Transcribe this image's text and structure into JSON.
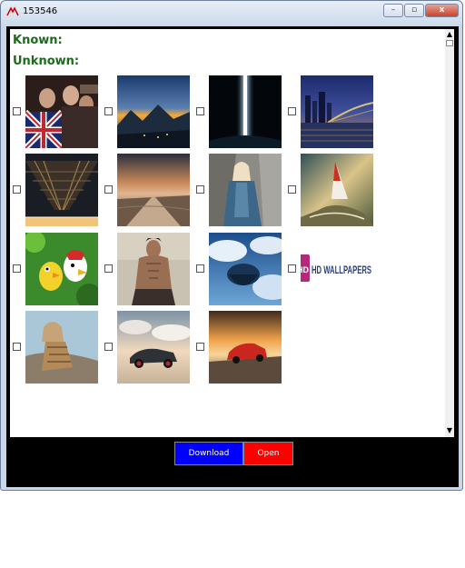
{
  "window": {
    "title": "153546",
    "minimize_label": "–",
    "maximize_label": "▫",
    "close_label": "x"
  },
  "labels": {
    "known": "Known:",
    "unknown": "Unknown:"
  },
  "gallery": {
    "images": [
      {
        "name": "movie-poster-three-men-flag",
        "checked": false
      },
      {
        "name": "mountain-sunset-town",
        "checked": false
      },
      {
        "name": "space-light-beam",
        "checked": false
      },
      {
        "name": "city-bridge-night",
        "checked": false
      },
      {
        "name": "bridge-underside-night",
        "checked": false
      },
      {
        "name": "beach-sunset-road",
        "checked": false
      },
      {
        "name": "woman-blue-cloak-rocks",
        "checked": false
      },
      {
        "name": "windsurfer-storm",
        "checked": false
      },
      {
        "name": "cartoon-birds-jungle",
        "checked": false
      },
      {
        "name": "wolverine-poster",
        "checked": false
      },
      {
        "name": "floating-island-clouds",
        "checked": false
      },
      {
        "name": "hd-wallpapers-logo",
        "checked": false,
        "text": "HD WALLPAPERS",
        "logo_badge": "HD"
      },
      {
        "name": "woman-posing-rocks",
        "checked": false
      },
      {
        "name": "sports-car-road-clouds",
        "checked": false
      },
      {
        "name": "red-car-sunset-road",
        "checked": false
      }
    ]
  },
  "buttons": {
    "download": "Download",
    "open": "Open"
  },
  "scrollbar": {
    "up": "▲",
    "down": "▼"
  },
  "colors": {
    "heading": "#1a6b1a",
    "download_bg": "#0000ff",
    "open_bg": "#ff0000"
  }
}
